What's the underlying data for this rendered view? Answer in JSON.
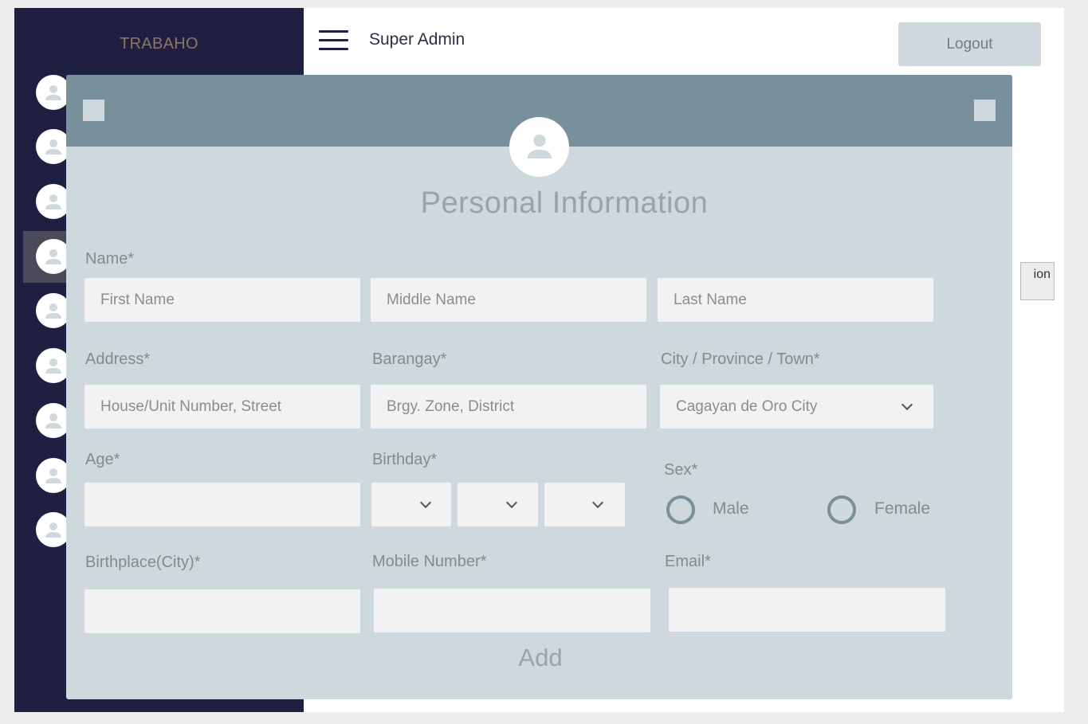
{
  "sidebar": {
    "brand": "TRABAHO",
    "items": [
      {
        "icon": "user-icon"
      },
      {
        "icon": "user-icon"
      },
      {
        "icon": "user-icon"
      },
      {
        "icon": "user-icon",
        "active": true
      },
      {
        "icon": "user-icon"
      },
      {
        "icon": "user-icon"
      },
      {
        "icon": "user-icon"
      },
      {
        "icon": "user-icon"
      },
      {
        "icon": "user-icon"
      }
    ]
  },
  "header": {
    "menu_icon": "hamburger-icon",
    "title": "Super Admin",
    "logout_label": "Logout"
  },
  "background": {
    "partial_button_text": "ion"
  },
  "modal": {
    "title": "Personal Information",
    "avatar_icon": "user-icon",
    "name_label": "Name*",
    "first_name_placeholder": "First Name",
    "middle_name_placeholder": "Middle Name",
    "last_name_placeholder": "Last Name",
    "address_label": "Address*",
    "address_placeholder": "House/Unit Number, Street",
    "barangay_label": "Barangay*",
    "barangay_placeholder": "Brgy. Zone, District",
    "city_label": "City / Province / Town*",
    "city_value": "Cagayan de Oro City",
    "age_label": "Age*",
    "age_value": "",
    "birthday_label": "Birthday*",
    "birthday_month": "",
    "birthday_day": "",
    "birthday_year": "",
    "sex_label": "Sex*",
    "sex_options": [
      "Male",
      "Female"
    ],
    "birthplace_label": "Birthplace(City)*",
    "birthplace_value": "",
    "mobile_label": "Mobile Number*",
    "mobile_value": "",
    "email_label": "Email*",
    "email_value": "",
    "add_label": "Add"
  },
  "colors": {
    "sidebar_bg": "#1f1f42",
    "brand": "#8c7760",
    "modal_header": "#78909c",
    "modal_body": "#cfd8dc",
    "field_bg": "#f2f2f2"
  }
}
